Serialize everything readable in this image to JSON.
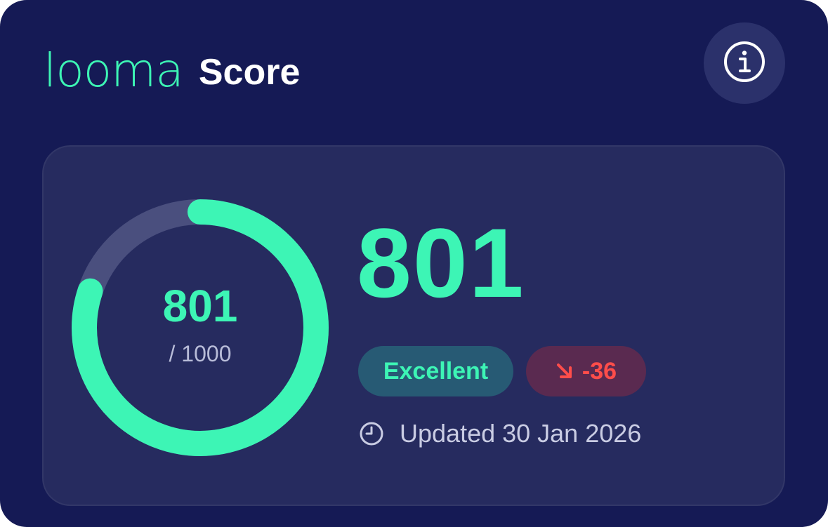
{
  "header": {
    "logo_text": "looma",
    "title": "Score",
    "info_icon": "info-icon"
  },
  "score": {
    "value": "801",
    "max_label": "/ 1000",
    "max": 1000,
    "progress": 0.801,
    "rating": "Excellent",
    "change": "-36",
    "change_icon": "arrow-down-right-icon",
    "updated": "Updated 30 Jan 2026",
    "updated_icon": "clock-icon"
  },
  "colors": {
    "background": "#151a55",
    "panel": "#262b5f",
    "accent": "#3df5b5",
    "negative": "#ff4d4a",
    "track": "#4a4f7e"
  }
}
